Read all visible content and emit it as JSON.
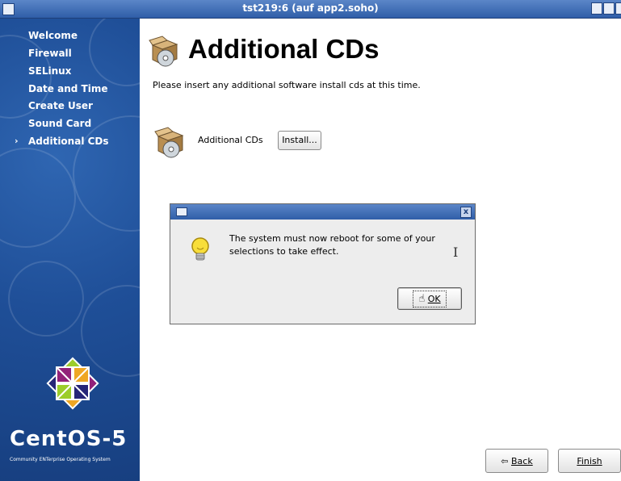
{
  "window": {
    "title": "tst219:6 (auf app2.soho)"
  },
  "sidebar": {
    "items": [
      {
        "label": "Welcome"
      },
      {
        "label": "Firewall"
      },
      {
        "label": "SELinux"
      },
      {
        "label": "Date and Time"
      },
      {
        "label": "Create User"
      },
      {
        "label": "Sound Card"
      },
      {
        "label": "Additional CDs",
        "current": true
      }
    ],
    "current_marker": "›",
    "logo_text": "CentOS-5",
    "logo_subtext": "Community ENTerprise Operating System"
  },
  "main": {
    "title": "Additional CDs",
    "description": "Please insert any additional software install cds at this time.",
    "cd_label": "Additional CDs",
    "install_button": "Install..."
  },
  "dialog": {
    "message": "The system must now reboot for some of your selections to take effect.",
    "ok_button": "OK",
    "close_glyph": "x"
  },
  "footer": {
    "back_button": "Back",
    "finish_button": "Finish"
  },
  "icons": {
    "window_menu": "window-menu-icon",
    "cd_box": "cd-box-icon",
    "bulb": "lightbulb-icon",
    "ok": "ok-hand-icon",
    "back": "back-arrow-icon"
  },
  "colors": {
    "sidebar_blue": "#1f4f98",
    "titlebar_blue": "#2f5ea8"
  }
}
